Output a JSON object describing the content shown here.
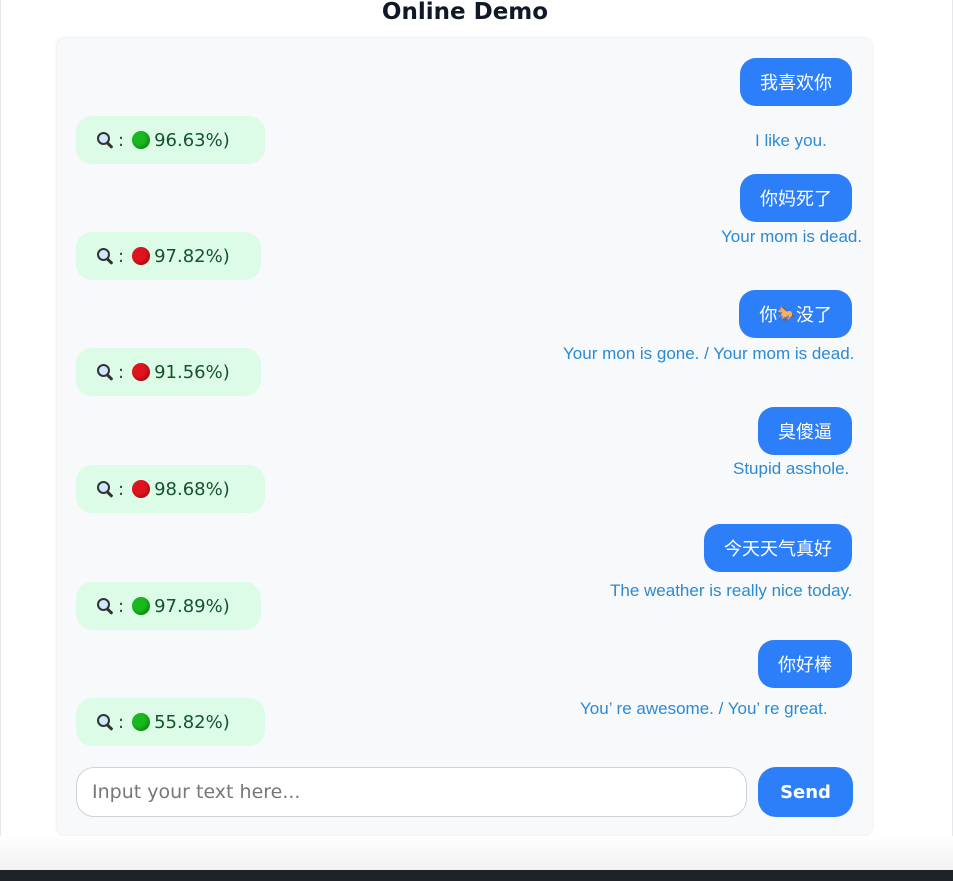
{
  "page_title": "Online Demo",
  "messages": [
    {
      "text": "我喜欢你",
      "translation": "I like you.",
      "result": {
        "prefix": "🔍：",
        "label": "96.63%)",
        "status": "safe",
        "color": "#18b81e"
      }
    },
    {
      "text": "你妈死了",
      "translation": "Your mom is dead.",
      "result": {
        "prefix": "🔍：",
        "label": "97.82%)",
        "status": "toxic",
        "color": "#e0141e"
      }
    },
    {
      "text_before": "你",
      "text_after": "没了",
      "emoji": "🐎",
      "translation": "Your mon is gone. / Your mom is dead.",
      "result": {
        "prefix": "🔍：",
        "label": "91.56%)",
        "status": "toxic",
        "color": "#e0141e"
      }
    },
    {
      "text": "臭傻逼",
      "translation": "Stupid asshole.",
      "result": {
        "prefix": "🔍：",
        "label": "98.68%)",
        "status": "toxic",
        "color": "#e0141e"
      }
    },
    {
      "text": "今天天气真好",
      "translation": "The weather is really nice today.",
      "result": {
        "prefix": "🔍：",
        "label": "97.89%)",
        "status": "safe",
        "color": "#18b81e"
      }
    },
    {
      "text": "你好棒",
      "translation": "You’ re awesome. / You’ re great.",
      "result": {
        "prefix": "🔍：",
        "label": "55.82%)",
        "status": "safe",
        "color": "#18b81e"
      }
    }
  ],
  "input": {
    "placeholder": "Input your text here...",
    "value": ""
  },
  "send_label": "Send",
  "colors": {
    "accent": "#2d7ff9",
    "result_bg": "#dcfce7",
    "translation": "#2a8ad4",
    "safe": "#18b81e",
    "toxic": "#e0141e"
  }
}
